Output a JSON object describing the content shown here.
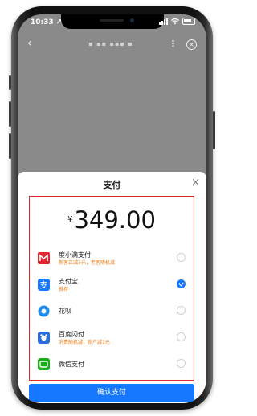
{
  "status_bar": {
    "time": "10:33 ↗"
  },
  "navbar": {
    "back": "‹",
    "title": "▪ ▪▪ ▪▪▪ ▪",
    "more": "⋮",
    "close": "×"
  },
  "sheet": {
    "title": "支付",
    "close": "×",
    "currency": "¥",
    "amount": "349.00",
    "methods": [
      {
        "name": "度小满支付",
        "sub": "新客立减3元，老客随机减",
        "icon": "duxiaoman-icon",
        "color": "#e0262e",
        "selected": false
      },
      {
        "name": "支付宝",
        "sub": "推荐",
        "icon": "alipay-icon",
        "color": "#1677ff",
        "selected": true
      },
      {
        "name": "花呗",
        "sub": "",
        "icon": "huabei-icon",
        "color": "#1a8cf0",
        "selected": false
      },
      {
        "name": "百度闪付",
        "sub": "消费随机减，新户减1元",
        "icon": "baidu-quickpay-icon",
        "color": "#2b6de0",
        "selected": false
      },
      {
        "name": "微信支付",
        "sub": "",
        "icon": "wechat-pay-icon",
        "color": "#1aad19",
        "selected": false
      }
    ],
    "confirm_label": "确认支付"
  },
  "colors": {
    "accent": "#1677ff",
    "highlight_border": "#e0262e",
    "subtext": "#f0821e"
  }
}
